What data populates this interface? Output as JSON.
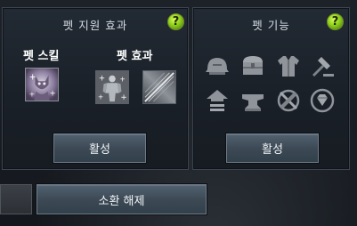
{
  "pet_support": {
    "title": "펫 지원 효과",
    "help_label": "?",
    "skill_label": "펫 스킬",
    "effect_label": "펫 효과",
    "skill_slot_icon": "pet-skill-portrait-icon",
    "effect_slot_icons": [
      "pet-effect-figure-icon",
      "pet-effect-streak-icon"
    ],
    "activate_label": "활성"
  },
  "pet_function": {
    "title": "펫 기능",
    "help_label": "?",
    "icons": [
      "helmet-icon",
      "treasure-chest-icon",
      "armor-vest-icon",
      "hammer-icon",
      "house-arrow-icon",
      "anvil-icon",
      "crossed-tools-icon",
      "diamond-gem-icon"
    ],
    "activate_label": "활성"
  },
  "footer": {
    "dismiss_label": "소환 해제"
  },
  "colors": {
    "help_button": "#8fcf1a",
    "panel_border": "#3b4450",
    "button_fill": "#3d4a56"
  }
}
